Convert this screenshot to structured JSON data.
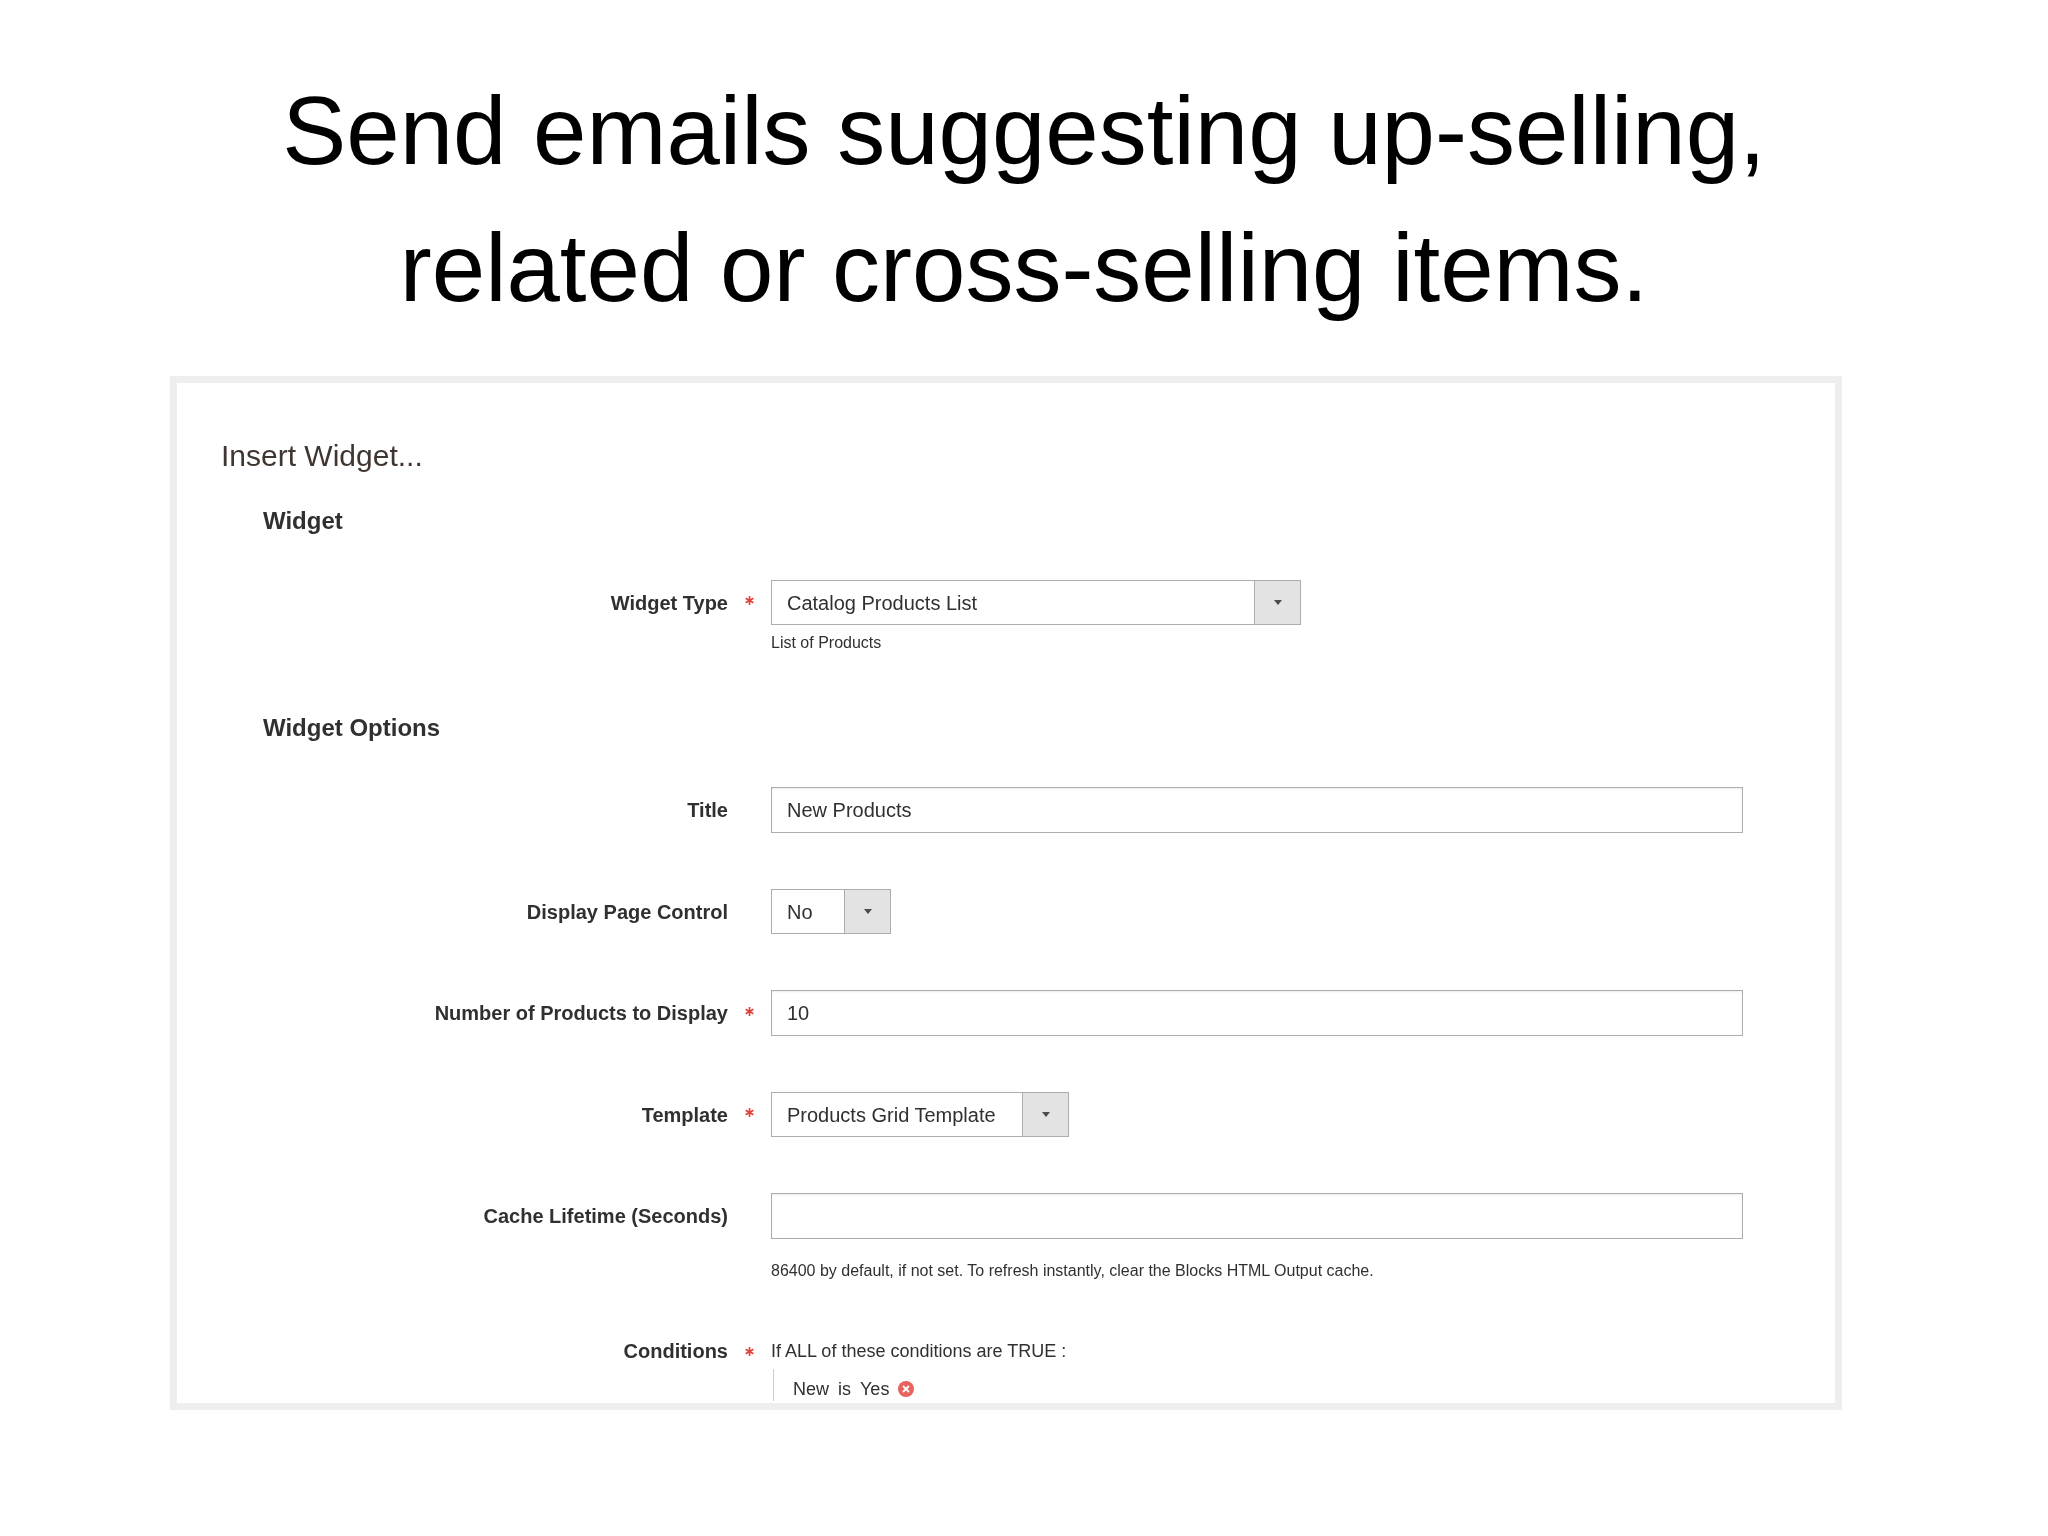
{
  "slide": {
    "title": "Send emails suggesting up-selling, related or cross-selling items."
  },
  "dialog": {
    "title": "Insert Widget...",
    "sections": [
      {
        "heading": "Widget",
        "fields": [
          {
            "kind": "select",
            "label": "Widget Type",
            "required": true,
            "value": "Catalog Products List",
            "note": "List of Products"
          }
        ]
      },
      {
        "heading": "Widget Options",
        "fields": [
          {
            "kind": "input",
            "label": "Title",
            "required": false,
            "value": "New Products"
          },
          {
            "kind": "select",
            "label": "Display Page Control",
            "required": false,
            "value": "No"
          },
          {
            "kind": "input",
            "label": "Number of Products to Display",
            "required": true,
            "value": "10"
          },
          {
            "kind": "select",
            "label": "Template",
            "required": true,
            "value": "Products Grid Template"
          },
          {
            "kind": "input",
            "label": "Cache Lifetime (Seconds)",
            "required": false,
            "note": "86400 by default, if not set. To refresh instantly, clear the Blocks HTML Output cache."
          },
          {
            "kind": "conditions",
            "label": "Conditions",
            "required": true,
            "intro": "If ALL of these conditions are TRUE :",
            "rules": [
              {
                "attribute": "New",
                "operator": "is",
                "value": "Yes"
              }
            ]
          }
        ]
      }
    ]
  }
}
